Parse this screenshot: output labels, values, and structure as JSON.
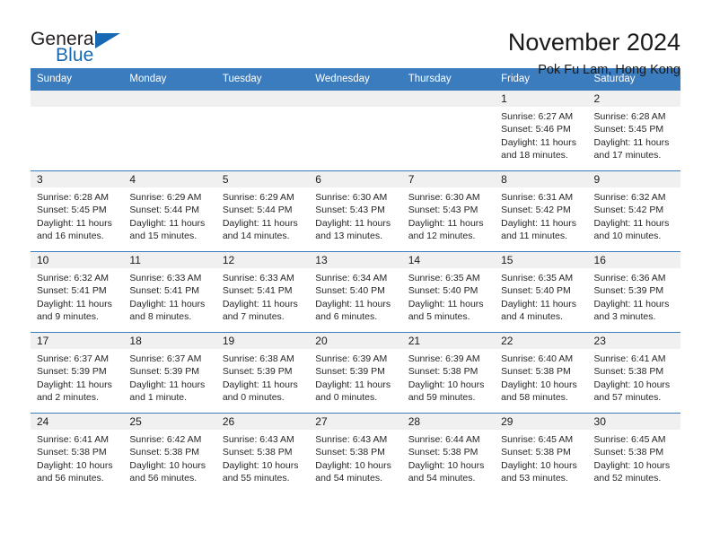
{
  "brand": {
    "word1": "General",
    "word2": "Blue",
    "accent_color": "#1769b4"
  },
  "header": {
    "title": "November 2024",
    "subtitle": "Pok Fu Lam, Hong Kong"
  },
  "calendar": {
    "header_bg": "#3a7cbe",
    "daynum_bg": "#f0f0f0",
    "weekdays": [
      "Sunday",
      "Monday",
      "Tuesday",
      "Wednesday",
      "Thursday",
      "Friday",
      "Saturday"
    ],
    "weeks": [
      [
        {
          "day": "",
          "lines": []
        },
        {
          "day": "",
          "lines": []
        },
        {
          "day": "",
          "lines": []
        },
        {
          "day": "",
          "lines": []
        },
        {
          "day": "",
          "lines": []
        },
        {
          "day": "1",
          "lines": [
            "Sunrise: 6:27 AM",
            "Sunset: 5:46 PM",
            "Daylight: 11 hours",
            "and 18 minutes."
          ]
        },
        {
          "day": "2",
          "lines": [
            "Sunrise: 6:28 AM",
            "Sunset: 5:45 PM",
            "Daylight: 11 hours",
            "and 17 minutes."
          ]
        }
      ],
      [
        {
          "day": "3",
          "lines": [
            "Sunrise: 6:28 AM",
            "Sunset: 5:45 PM",
            "Daylight: 11 hours",
            "and 16 minutes."
          ]
        },
        {
          "day": "4",
          "lines": [
            "Sunrise: 6:29 AM",
            "Sunset: 5:44 PM",
            "Daylight: 11 hours",
            "and 15 minutes."
          ]
        },
        {
          "day": "5",
          "lines": [
            "Sunrise: 6:29 AM",
            "Sunset: 5:44 PM",
            "Daylight: 11 hours",
            "and 14 minutes."
          ]
        },
        {
          "day": "6",
          "lines": [
            "Sunrise: 6:30 AM",
            "Sunset: 5:43 PM",
            "Daylight: 11 hours",
            "and 13 minutes."
          ]
        },
        {
          "day": "7",
          "lines": [
            "Sunrise: 6:30 AM",
            "Sunset: 5:43 PM",
            "Daylight: 11 hours",
            "and 12 minutes."
          ]
        },
        {
          "day": "8",
          "lines": [
            "Sunrise: 6:31 AM",
            "Sunset: 5:42 PM",
            "Daylight: 11 hours",
            "and 11 minutes."
          ]
        },
        {
          "day": "9",
          "lines": [
            "Sunrise: 6:32 AM",
            "Sunset: 5:42 PM",
            "Daylight: 11 hours",
            "and 10 minutes."
          ]
        }
      ],
      [
        {
          "day": "10",
          "lines": [
            "Sunrise: 6:32 AM",
            "Sunset: 5:41 PM",
            "Daylight: 11 hours",
            "and 9 minutes."
          ]
        },
        {
          "day": "11",
          "lines": [
            "Sunrise: 6:33 AM",
            "Sunset: 5:41 PM",
            "Daylight: 11 hours",
            "and 8 minutes."
          ]
        },
        {
          "day": "12",
          "lines": [
            "Sunrise: 6:33 AM",
            "Sunset: 5:41 PM",
            "Daylight: 11 hours",
            "and 7 minutes."
          ]
        },
        {
          "day": "13",
          "lines": [
            "Sunrise: 6:34 AM",
            "Sunset: 5:40 PM",
            "Daylight: 11 hours",
            "and 6 minutes."
          ]
        },
        {
          "day": "14",
          "lines": [
            "Sunrise: 6:35 AM",
            "Sunset: 5:40 PM",
            "Daylight: 11 hours",
            "and 5 minutes."
          ]
        },
        {
          "day": "15",
          "lines": [
            "Sunrise: 6:35 AM",
            "Sunset: 5:40 PM",
            "Daylight: 11 hours",
            "and 4 minutes."
          ]
        },
        {
          "day": "16",
          "lines": [
            "Sunrise: 6:36 AM",
            "Sunset: 5:39 PM",
            "Daylight: 11 hours",
            "and 3 minutes."
          ]
        }
      ],
      [
        {
          "day": "17",
          "lines": [
            "Sunrise: 6:37 AM",
            "Sunset: 5:39 PM",
            "Daylight: 11 hours",
            "and 2 minutes."
          ]
        },
        {
          "day": "18",
          "lines": [
            "Sunrise: 6:37 AM",
            "Sunset: 5:39 PM",
            "Daylight: 11 hours",
            "and 1 minute."
          ]
        },
        {
          "day": "19",
          "lines": [
            "Sunrise: 6:38 AM",
            "Sunset: 5:39 PM",
            "Daylight: 11 hours",
            "and 0 minutes."
          ]
        },
        {
          "day": "20",
          "lines": [
            "Sunrise: 6:39 AM",
            "Sunset: 5:39 PM",
            "Daylight: 11 hours",
            "and 0 minutes."
          ]
        },
        {
          "day": "21",
          "lines": [
            "Sunrise: 6:39 AM",
            "Sunset: 5:38 PM",
            "Daylight: 10 hours",
            "and 59 minutes."
          ]
        },
        {
          "day": "22",
          "lines": [
            "Sunrise: 6:40 AM",
            "Sunset: 5:38 PM",
            "Daylight: 10 hours",
            "and 58 minutes."
          ]
        },
        {
          "day": "23",
          "lines": [
            "Sunrise: 6:41 AM",
            "Sunset: 5:38 PM",
            "Daylight: 10 hours",
            "and 57 minutes."
          ]
        }
      ],
      [
        {
          "day": "24",
          "lines": [
            "Sunrise: 6:41 AM",
            "Sunset: 5:38 PM",
            "Daylight: 10 hours",
            "and 56 minutes."
          ]
        },
        {
          "day": "25",
          "lines": [
            "Sunrise: 6:42 AM",
            "Sunset: 5:38 PM",
            "Daylight: 10 hours",
            "and 56 minutes."
          ]
        },
        {
          "day": "26",
          "lines": [
            "Sunrise: 6:43 AM",
            "Sunset: 5:38 PM",
            "Daylight: 10 hours",
            "and 55 minutes."
          ]
        },
        {
          "day": "27",
          "lines": [
            "Sunrise: 6:43 AM",
            "Sunset: 5:38 PM",
            "Daylight: 10 hours",
            "and 54 minutes."
          ]
        },
        {
          "day": "28",
          "lines": [
            "Sunrise: 6:44 AM",
            "Sunset: 5:38 PM",
            "Daylight: 10 hours",
            "and 54 minutes."
          ]
        },
        {
          "day": "29",
          "lines": [
            "Sunrise: 6:45 AM",
            "Sunset: 5:38 PM",
            "Daylight: 10 hours",
            "and 53 minutes."
          ]
        },
        {
          "day": "30",
          "lines": [
            "Sunrise: 6:45 AM",
            "Sunset: 5:38 PM",
            "Daylight: 10 hours",
            "and 52 minutes."
          ]
        }
      ]
    ]
  }
}
